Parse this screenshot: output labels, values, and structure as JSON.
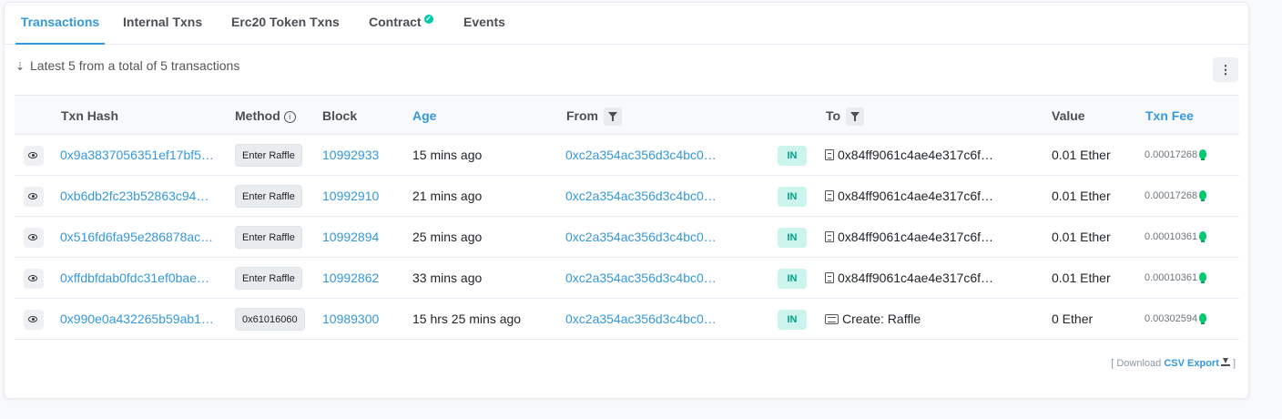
{
  "tabs": [
    {
      "label": "Transactions",
      "active": true
    },
    {
      "label": "Internal Txns",
      "active": false
    },
    {
      "label": "Erc20 Token Txns",
      "active": false
    },
    {
      "label": "Contract",
      "active": false,
      "verified_icon": "check-circle-icon"
    },
    {
      "label": "Events",
      "active": false
    }
  ],
  "summary": {
    "text": "Latest 5 from a total of 5 transactions",
    "icon": "sort-amount-down-icon"
  },
  "menu_icon": "vertical-ellipsis-icon",
  "table": {
    "headers": {
      "txn_hash": "Txn Hash",
      "method": "Method",
      "block": "Block",
      "age": "Age",
      "from": "From",
      "to": "To",
      "value": "Value",
      "txn_fee": "Txn Fee"
    },
    "rows": [
      {
        "hash": "0x9a3837056351ef17bf5…",
        "method": "Enter Raffle",
        "block": "10992933",
        "age": "15 mins ago",
        "from": "0xc2a354ac356d3c4bc0…",
        "direction": "IN",
        "to": "0x84ff9061c4ae4e317c6f…",
        "to_type": "contract",
        "value": "0.01 Ether",
        "fee": "0.00017268"
      },
      {
        "hash": "0xb6db2fc23b52863c94…",
        "method": "Enter Raffle",
        "block": "10992910",
        "age": "21 mins ago",
        "from": "0xc2a354ac356d3c4bc0…",
        "direction": "IN",
        "to": "0x84ff9061c4ae4e317c6f…",
        "to_type": "contract",
        "value": "0.01 Ether",
        "fee": "0.00017268"
      },
      {
        "hash": "0x516fd6fa95e286878ac…",
        "method": "Enter Raffle",
        "block": "10992894",
        "age": "25 mins ago",
        "from": "0xc2a354ac356d3c4bc0…",
        "direction": "IN",
        "to": "0x84ff9061c4ae4e317c6f…",
        "to_type": "contract",
        "value": "0.01 Ether",
        "fee": "0.00010361"
      },
      {
        "hash": "0xffdbfdab0fdc31ef0bae…",
        "method": "Enter Raffle",
        "block": "10992862",
        "age": "33 mins ago",
        "from": "0xc2a354ac356d3c4bc0…",
        "direction": "IN",
        "to": "0x84ff9061c4ae4e317c6f…",
        "to_type": "contract",
        "value": "0.01 Ether",
        "fee": "0.00010361"
      },
      {
        "hash": "0x990e0a432265b59ab1…",
        "method": "0x61016060",
        "block": "10989300",
        "age": "15 hrs 25 mins ago",
        "from": "0xc2a354ac356d3c4bc0…",
        "direction": "IN",
        "to": "Create: Raffle",
        "to_type": "create",
        "value": "0 Ether",
        "fee": "0.00302594"
      }
    ]
  },
  "footer": {
    "prefix": "[ Download",
    "csv_label": "CSV Export",
    "suffix": "]"
  },
  "colors": {
    "accent": "#3498db",
    "in_badge_bg": "#ccf4ec",
    "in_badge_text": "#00a186",
    "gas_bulb": "#00c96e"
  }
}
